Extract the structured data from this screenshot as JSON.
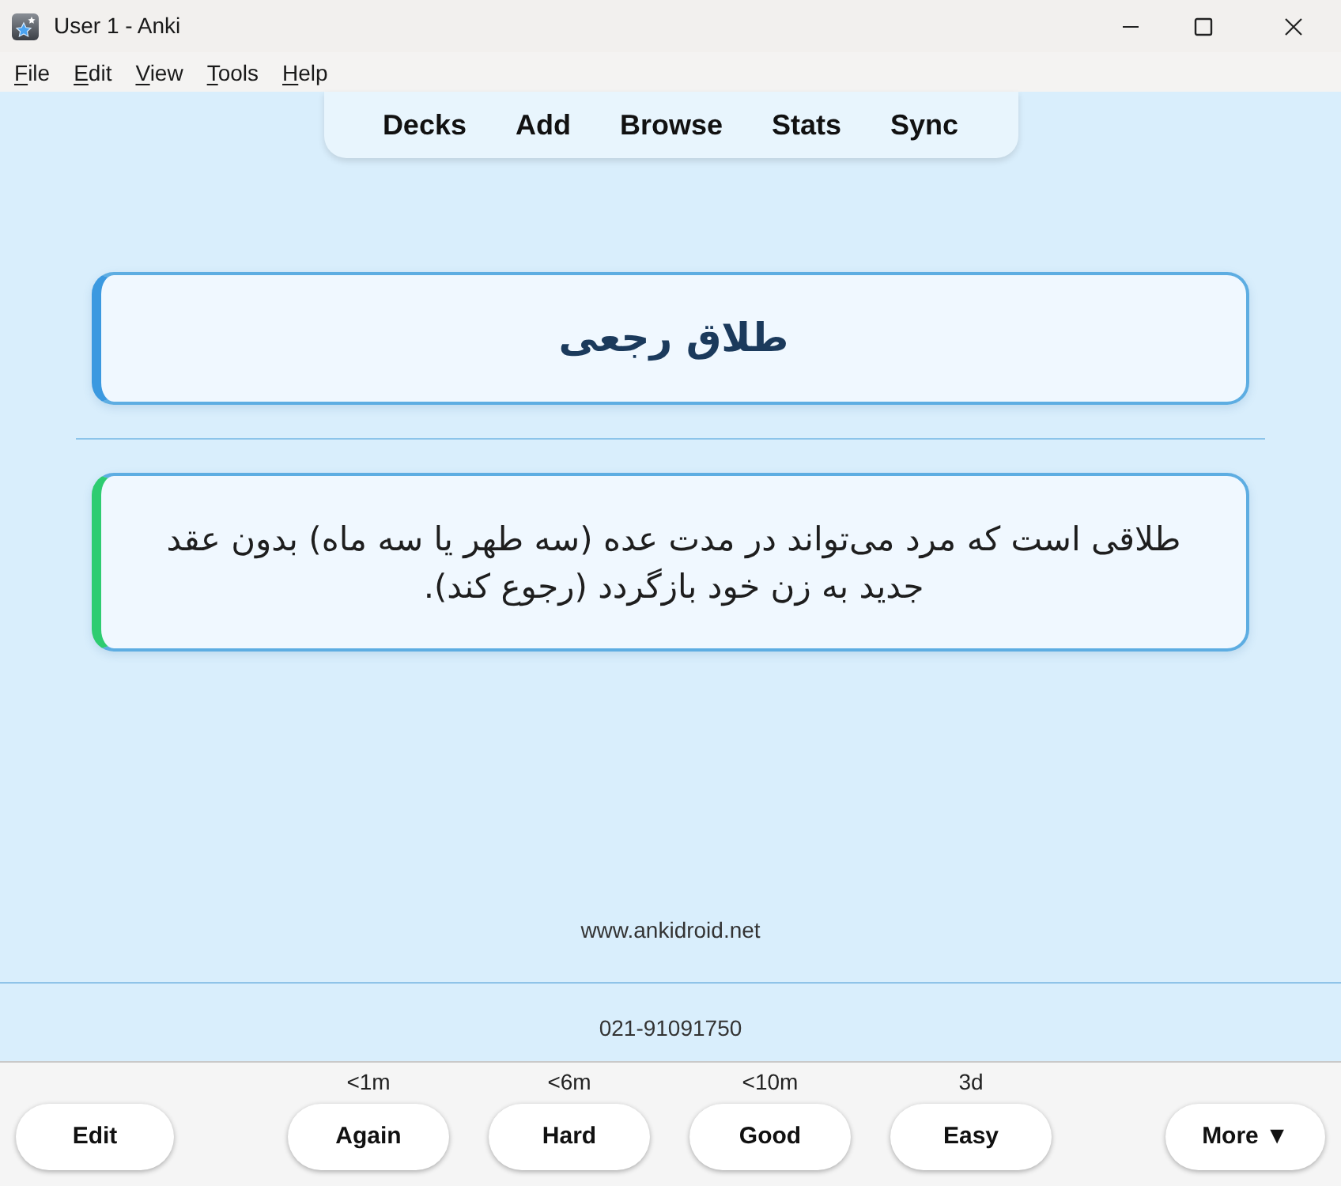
{
  "window": {
    "title": "User 1 - Anki"
  },
  "menu": [
    "File",
    "Edit",
    "View",
    "Tools",
    "Help"
  ],
  "toolbar": [
    "Decks",
    "Add",
    "Browse",
    "Stats",
    "Sync"
  ],
  "fields": [
    {
      "kind": "question",
      "text": "طلاق رجعی",
      "color": "#3b99e0"
    },
    {
      "kind": "answer",
      "text": "طلاقی است که مرد می‌تواند در مدت عده (سه طهر یا سه ماه) بدون عقد جدید به زن خود بازگردد (رجوع کند).",
      "color": "#2ecc71"
    }
  ],
  "footer": {
    "website": "www.ankidroid.net",
    "phone": "021-91091750"
  },
  "answer_bar": {
    "edit_button": "Edit",
    "answers": [
      {
        "interval": "<1m",
        "label": "Again"
      },
      {
        "interval": "<6m",
        "label": "Hard"
      },
      {
        "interval": "<10m",
        "label": "Good"
      },
      {
        "interval": "3d",
        "label": "Easy"
      }
    ],
    "more_button": "More ▼"
  }
}
